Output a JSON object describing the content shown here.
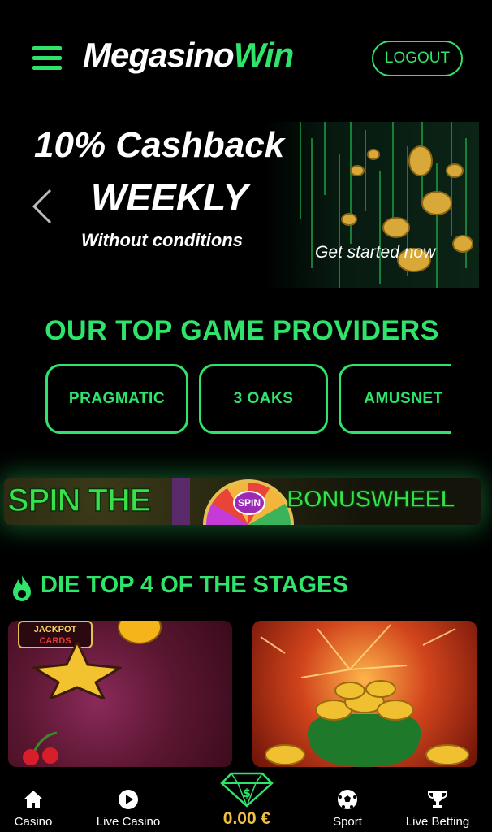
{
  "header": {
    "logo_part1": "Megasino",
    "logo_part2": "Win",
    "logout_label": "LOGOUT"
  },
  "banner": {
    "title": "10% Cashback",
    "title2": "WEEKLY",
    "subtitle": "Without conditions",
    "cta": "Get started now"
  },
  "providers": {
    "title": "OUR TOP GAME PROVIDERS",
    "items": [
      {
        "label": "PRAGMATIC"
      },
      {
        "label": "3 OAKS"
      },
      {
        "label": "AMUSNET"
      }
    ]
  },
  "wheel_banner": {
    "text_left": "SPIN THE",
    "spin": "SPIN",
    "text_right": "BONUSWHEEL"
  },
  "stages": {
    "title": "DIE TOP 4 OF THE STAGES",
    "card1_badge_top": "JACKPOT",
    "card1_badge_bottom": "CARDS"
  },
  "bottom_nav": {
    "casino": "Casino",
    "live_casino": "Live Casino",
    "balance": "0.00 €",
    "sport": "Sport",
    "live_betting": "Live Betting"
  },
  "colors": {
    "accent": "#2fe46a",
    "balance": "#f0c040",
    "background": "#000000"
  }
}
